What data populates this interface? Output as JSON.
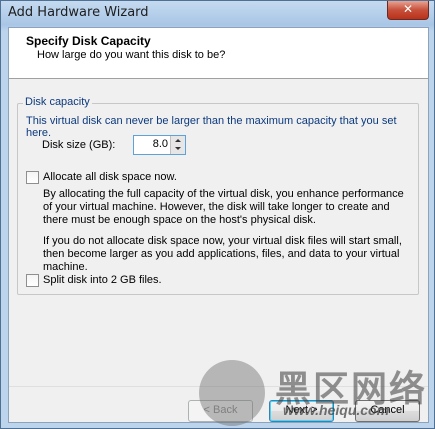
{
  "window": {
    "title": "Add Hardware Wizard",
    "close_glyph": "✕"
  },
  "header": {
    "title": "Specify Disk Capacity",
    "subtitle": "How large do you want this disk to be?"
  },
  "disk_capacity": {
    "group_label": "Disk capacity",
    "description": "This virtual disk can never be larger than the maximum capacity that you set here.",
    "size_label": "Disk size (GB):",
    "size_value": "8.0"
  },
  "allocate": {
    "label": "Allocate all disk space now.",
    "checked": false,
    "para1": "By allocating the full capacity of the virtual disk, you enhance performance of your virtual machine.  However, the disk will take longer to create and there must be enough space on the host's physical disk.",
    "para2": "If you do not allocate disk space now, your virtual disk files will start small, then become larger as you add applications, files, and data to your virtual machine."
  },
  "split": {
    "label": "Split disk into 2 GB files.",
    "checked": false
  },
  "buttons": {
    "back": "< Back",
    "next": "Next >",
    "cancel": "Cancel"
  },
  "watermark": {
    "text": "黑区网络",
    "url": "www.heiqu.com"
  }
}
